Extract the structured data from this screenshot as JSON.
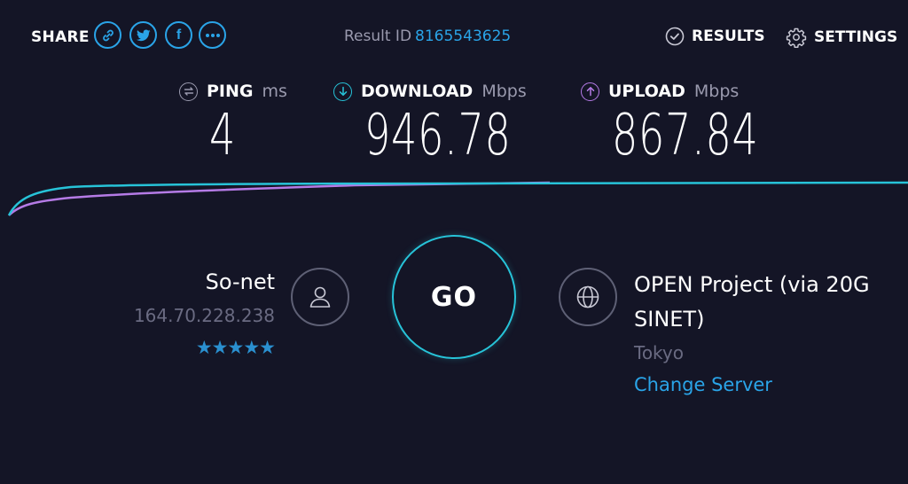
{
  "header": {
    "share_label": "SHARE",
    "share_icons": [
      "link-icon",
      "twitter-icon",
      "facebook-icon",
      "more-icon"
    ],
    "result_id_label": "Result ID",
    "result_id_value": "8165543625",
    "results_label": "RESULTS",
    "settings_label": "SETTINGS"
  },
  "metrics": {
    "ping": {
      "label": "PING",
      "unit": "ms",
      "value": "4",
      "icon": "ping-icon",
      "color": "#9a9aae"
    },
    "download": {
      "label": "DOWNLOAD",
      "unit": "Mbps",
      "value": "946.78",
      "icon": "download-arrow-icon",
      "color": "#27c3d8"
    },
    "upload": {
      "label": "UPLOAD",
      "unit": "Mbps",
      "value": "867.84",
      "icon": "upload-arrow-icon",
      "color": "#b57be6"
    }
  },
  "isp": {
    "name": "So-net",
    "ip": "164.70.228.238",
    "stars": "★★★★★",
    "icon": "user-icon"
  },
  "go_label": "GO",
  "server": {
    "name": "OPEN Project (via 20G SINET)",
    "location": "Tokyo",
    "change_label": "Change Server",
    "icon": "globe-icon"
  },
  "colors": {
    "background": "#141526",
    "accent_blue": "#2aa4e8",
    "download_line": "#27c3d8",
    "upload_line": "#b57be6"
  }
}
